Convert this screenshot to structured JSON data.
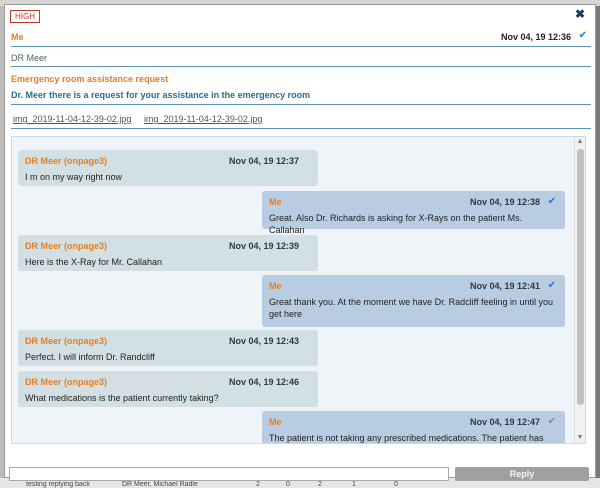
{
  "background": {
    "bottom_row": [
      "testing replying back",
      "DR Meer, Michael Radle",
      "2",
      "0",
      "2",
      "1",
      "0"
    ]
  },
  "modal": {
    "priority": "HIGH",
    "close_glyph": "✖",
    "from": "Me",
    "date": "Nov 04, 19 12:36",
    "to": "DR Meer",
    "subject": "Emergency room assistance request",
    "body": "Dr. Meer there is a request for your assistance in the emergency room",
    "attachments": [
      "img_2019-11-04-12-39-02.jpg",
      "img_2019-11-04-12-39-02.jpg"
    ]
  },
  "messages": [
    {
      "direction": "in",
      "sender": "DR Meer (onpage3)",
      "date": "Nov 04, 19 12:37",
      "text": "I m on my way right now"
    },
    {
      "direction": "out",
      "sender": "Me",
      "date": "Nov 04, 19 12:38",
      "text": "Great. Also Dr. Richards is asking for X-Rays on the patient Ms. Callahan",
      "read": true
    },
    {
      "direction": "in",
      "sender": "DR Meer (onpage3)",
      "date": "Nov 04, 19 12:39",
      "text": "Here is the X-Ray for Mr. Callahan"
    },
    {
      "direction": "out",
      "sender": "Me",
      "date": "Nov 04, 19 12:41",
      "text": "Great thank you. At the moment we have Dr. Radcliff feeling in until you get here",
      "read": true
    },
    {
      "direction": "in",
      "sender": "DR Meer (onpage3)",
      "date": "Nov 04, 19 12:43",
      "text": "Perfect. I will inform Dr. Randcliff"
    },
    {
      "direction": "in",
      "sender": "DR Meer (onpage3)",
      "date": "Nov 04, 19 12:46",
      "text": "What medications is the patient currently taking?"
    },
    {
      "direction": "out",
      "sender": "Me",
      "date": "Nov 04, 19 12:47",
      "text": "The patient is not taking any prescribed medications. The patient has said",
      "read": false
    }
  ],
  "reply": {
    "input_value": "",
    "button_label": "Reply"
  },
  "colors": {
    "sender_orange": "#e67e22",
    "incoming_bubble": "#d2e0e3",
    "outgoing_bubble": "#b8cde1",
    "read_check": "#2a6fd1",
    "priority_red": "#c0392b"
  }
}
